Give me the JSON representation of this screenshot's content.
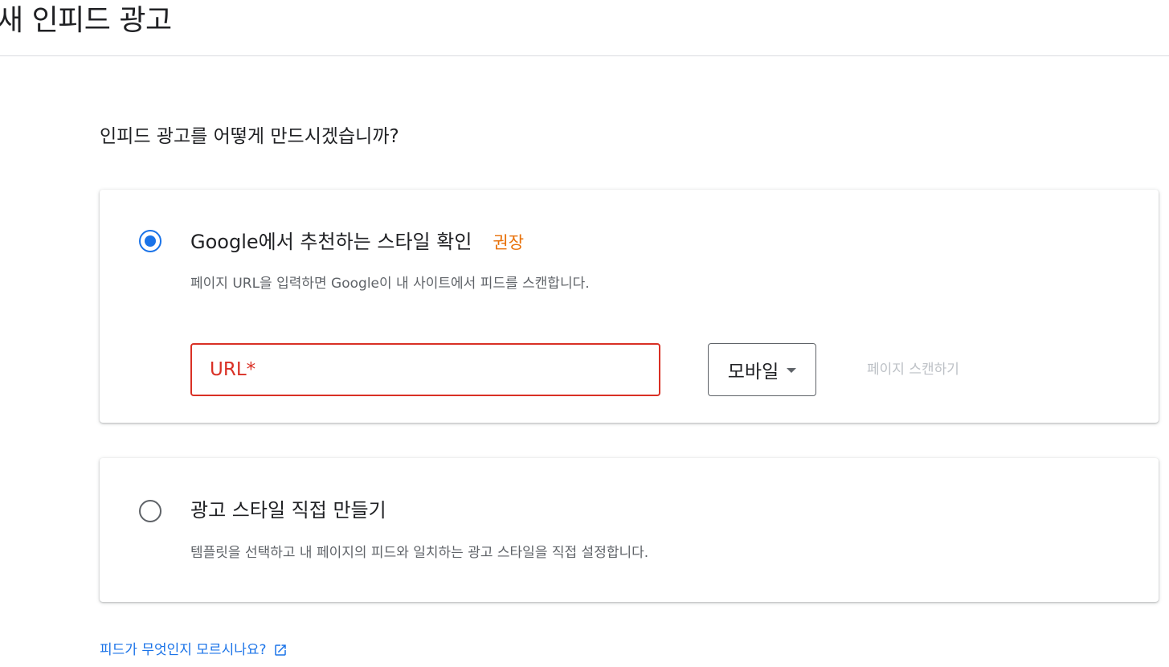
{
  "header": {
    "title": "새 인피드 광고"
  },
  "question": "인피드 광고를 어떻게 만드시겠습니까?",
  "options": [
    {
      "title": "Google에서 추천하는 스타일 확인",
      "badge": "권장",
      "description": "페이지 URL을 입력하면 Google이 내 사이트에서 피드를 스캔합니다.",
      "selected": true,
      "url_field": {
        "placeholder": "URL*",
        "value": ""
      },
      "device_select": {
        "selected": "모바일"
      },
      "scan_button": "페이지 스캔하기"
    },
    {
      "title": "광고 스타일 직접 만들기",
      "description": "템플릿을 선택하고 내 페이지의 피드와 일치하는 광고 스타일을 직접 설정합니다.",
      "selected": false
    }
  ],
  "help_link": {
    "label": "피드가 무엇인지 모르시나요?",
    "icon": "open-in-new-icon"
  },
  "colors": {
    "accent": "#1a73e8",
    "error": "#d93025",
    "badge": "#e8710a",
    "disabled": "#bdc1c6"
  }
}
